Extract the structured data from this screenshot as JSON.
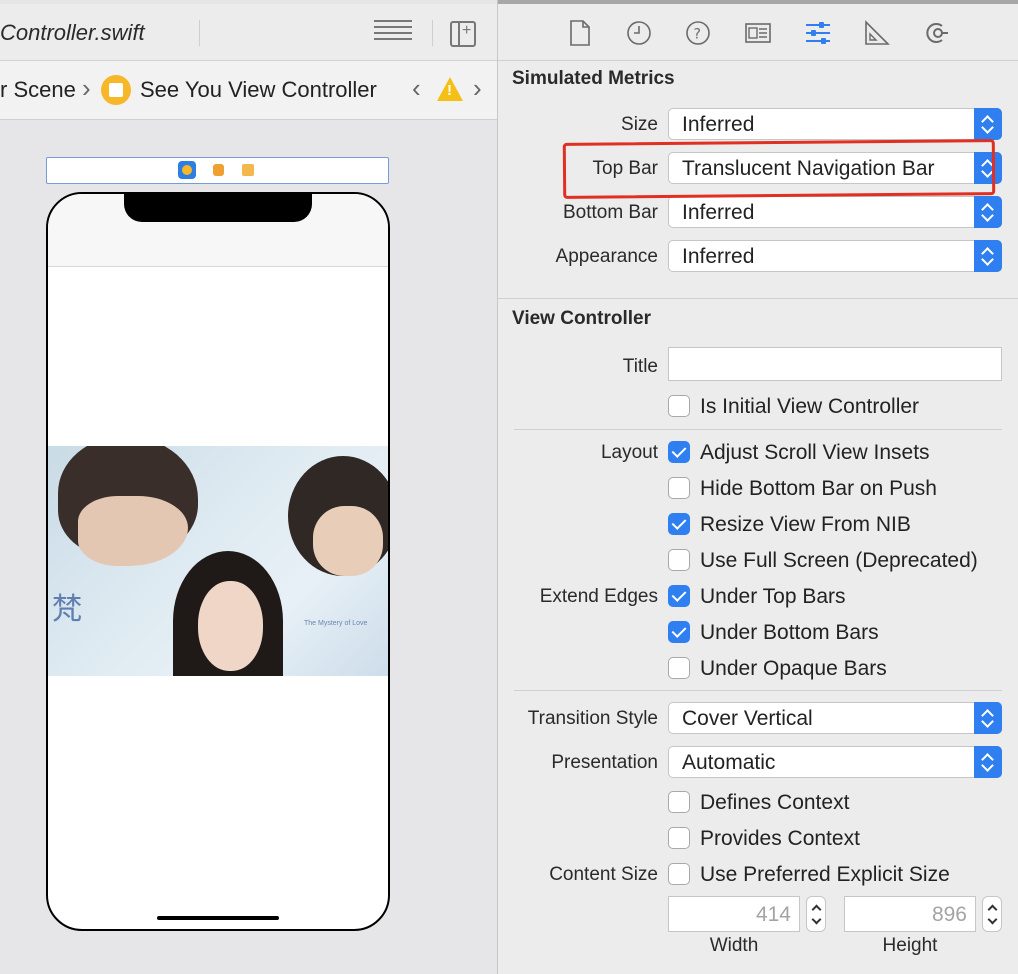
{
  "editor": {
    "filename": "Controller.swift",
    "breadcrumb_scene": "r Scene",
    "breadcrumb_controller": "See You View Controller",
    "warning_glyph": "!"
  },
  "canvas": {
    "photo_text_chinese": "梵",
    "photo_text_sub": "The Mystery of Love"
  },
  "inspector": {
    "tabs": [
      "file-icon",
      "history-icon",
      "help-icon",
      "identity-icon",
      "attributes-icon",
      "size-icon",
      "connections-icon"
    ],
    "simulated_metrics": {
      "title": "Simulated Metrics",
      "size_label": "Size",
      "size_value": "Inferred",
      "top_bar_label": "Top Bar",
      "top_bar_value": "Translucent Navigation Bar",
      "bottom_bar_label": "Bottom Bar",
      "bottom_bar_value": "Inferred",
      "appearance_label": "Appearance",
      "appearance_value": "Inferred"
    },
    "view_controller": {
      "title": "View Controller",
      "title_label": "Title",
      "title_value": "",
      "initial_vc": "Is Initial View Controller",
      "layout_label": "Layout",
      "adjust_scroll": "Adjust Scroll View Insets",
      "hide_bottom": "Hide Bottom Bar on Push",
      "resize_nib": "Resize View From NIB",
      "full_screen": "Use Full Screen (Deprecated)",
      "extend_edges_label": "Extend Edges",
      "under_top": "Under Top Bars",
      "under_bottom": "Under Bottom Bars",
      "under_opaque": "Under Opaque Bars",
      "transition_label": "Transition Style",
      "transition_value": "Cover Vertical",
      "presentation_label": "Presentation",
      "presentation_value": "Automatic",
      "defines_context": "Defines Context",
      "provides_context": "Provides Context",
      "content_size_label": "Content Size",
      "preferred_size": "Use Preferred Explicit Size",
      "width_value": "414",
      "height_value": "896",
      "width_label": "Width",
      "height_label": "Height"
    },
    "checkbox_states": {
      "initial_vc": false,
      "adjust_scroll": true,
      "hide_bottom": false,
      "resize_nib": true,
      "full_screen": false,
      "under_top": true,
      "under_bottom": true,
      "under_opaque": false,
      "defines_context": false,
      "provides_context": false,
      "preferred_size": false
    }
  },
  "colors": {
    "accent": "#2f7ff1",
    "highlight": "#e12f22",
    "warning": "#f4c016",
    "vc_icon": "#f6b829"
  }
}
